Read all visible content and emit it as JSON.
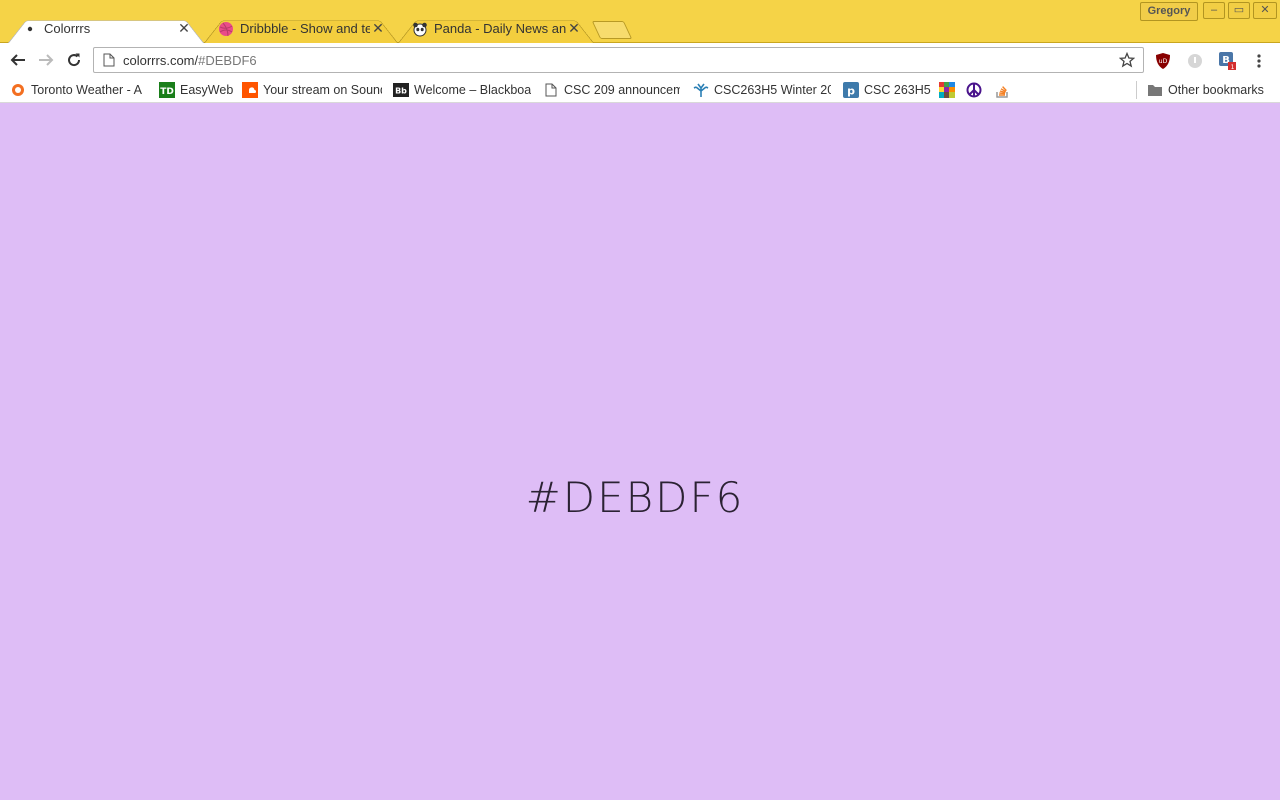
{
  "window": {
    "profile_name": "Gregory",
    "frame_color": "#f5d347"
  },
  "tabs": [
    {
      "title": "Colorrrs",
      "icon": "dot-icon",
      "active": true
    },
    {
      "title": "Dribbble - Show and tell",
      "icon": "dribbble-icon",
      "active": false
    },
    {
      "title": "Panda - Daily News and",
      "icon": "panda-icon",
      "active": false
    }
  ],
  "toolbar": {
    "url_host": "colorrrs.com/",
    "url_path": "#DEBDF6"
  },
  "bookmarks": [
    {
      "label": "Toronto Weather - A",
      "icon": "weather-sun-icon"
    },
    {
      "label": "EasyWeb",
      "icon": "td-bank-icon"
    },
    {
      "label": "Your stream on Sound",
      "icon": "soundcloud-icon"
    },
    {
      "label": "Welcome – Blackboa",
      "icon": "blackboard-icon"
    },
    {
      "label": "CSC 209 announcem",
      "icon": "page-icon"
    },
    {
      "label": "CSC263H5 Winter 20",
      "icon": "tree-icon"
    },
    {
      "label": "CSC 263H5",
      "icon": "piazza-icon"
    },
    {
      "label": "",
      "icon": "mosaic-icon"
    },
    {
      "label": "",
      "icon": "peace-icon"
    },
    {
      "label": "",
      "icon": "stackoverflow-icon"
    }
  ],
  "other_bookmarks": {
    "label": "Other bookmarks",
    "icon": "folder-icon"
  },
  "page": {
    "background": "#debdf6",
    "hex": "#DEBDF6"
  }
}
